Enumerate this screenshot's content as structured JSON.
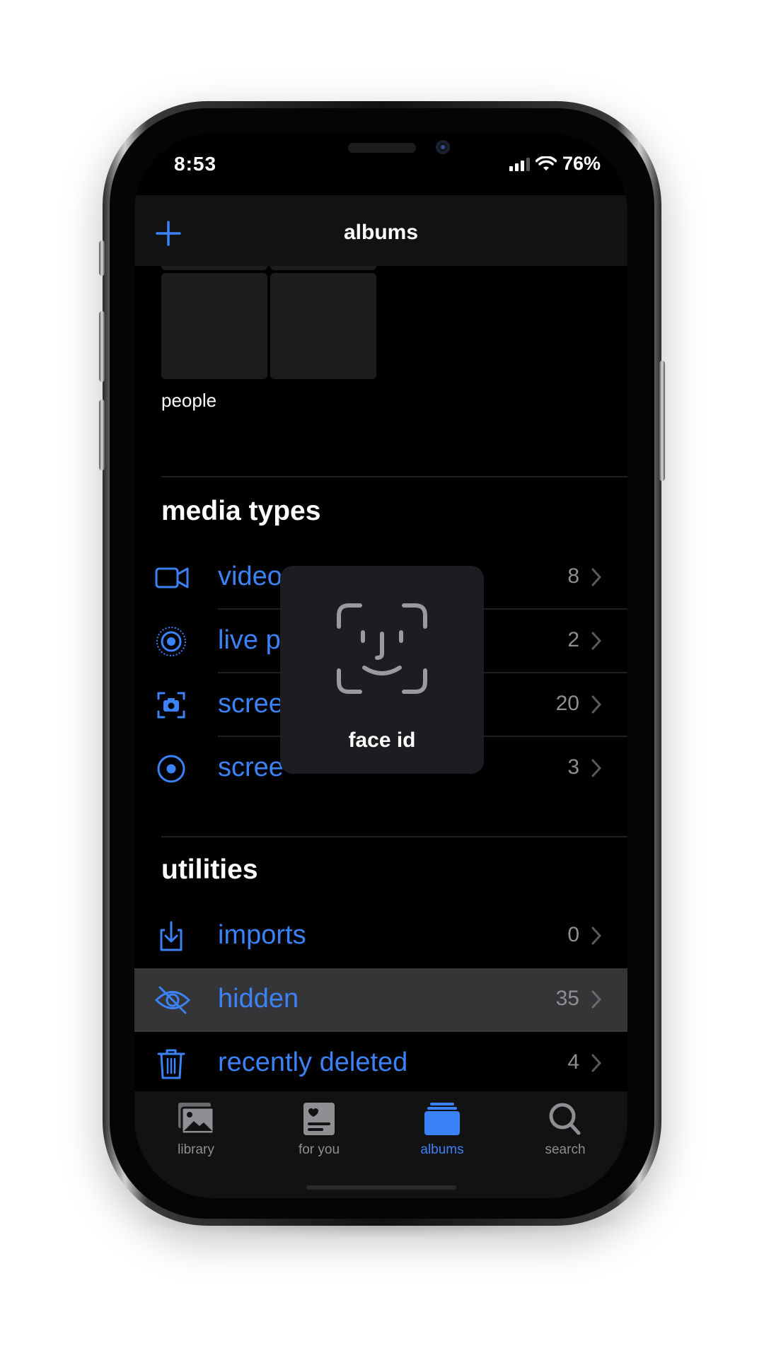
{
  "status": {
    "time": "8:53",
    "battery": "76%"
  },
  "navbar": {
    "title": "albums"
  },
  "people": {
    "label": "people"
  },
  "media_types": {
    "title": "media types",
    "items": [
      {
        "label": "videos",
        "count": "8",
        "icon": "video-camera-icon"
      },
      {
        "label": "live p",
        "count": "2",
        "icon": "live-photo-icon"
      },
      {
        "label": "scree",
        "count": "20",
        "icon": "screenshot-icon"
      },
      {
        "label": "scree",
        "count": "3",
        "icon": "screen-recording-icon"
      }
    ]
  },
  "utilities": {
    "title": "utilities",
    "items": [
      {
        "label": "imports",
        "count": "0",
        "icon": "import-tray-icon"
      },
      {
        "label": "hidden",
        "count": "35",
        "icon": "eye-slash-icon"
      },
      {
        "label": "recently deleted",
        "count": "4",
        "icon": "trash-icon"
      }
    ]
  },
  "faceid": {
    "label": "face id"
  },
  "tabs": [
    {
      "label": "library",
      "icon": "photo-library-icon"
    },
    {
      "label": "for you",
      "icon": "for-you-icon"
    },
    {
      "label": "albums",
      "icon": "albums-stack-icon"
    },
    {
      "label": "search",
      "icon": "magnifier-icon"
    }
  ],
  "colors": {
    "accent": "#3b82f6",
    "background": "#000000",
    "bar": "#121212",
    "highlight": "#353537"
  }
}
